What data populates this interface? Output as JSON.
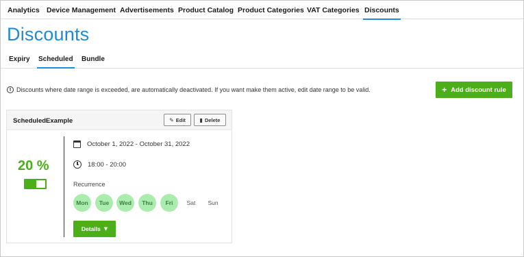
{
  "topnav": {
    "tabs": [
      {
        "label": "Analytics"
      },
      {
        "label": "Device Management"
      },
      {
        "label": "Advertisements"
      },
      {
        "label": "Product Catalog"
      },
      {
        "label": "Product Categories"
      },
      {
        "label": "VAT Categories"
      },
      {
        "label": "Discounts",
        "active": true
      }
    ]
  },
  "page": {
    "title": "Discounts"
  },
  "subnav": {
    "tabs": [
      {
        "label": "Expiry"
      },
      {
        "label": "Scheduled",
        "active": true
      },
      {
        "label": "Bundle"
      }
    ]
  },
  "info": {
    "icon": "info-circle-icon",
    "text": "Discounts where date range is exceeded, are automatically deactivated. If you want make them active, edit date range to be valid."
  },
  "add_button": {
    "label": "Add discount rule",
    "icon": "plus-icon"
  },
  "card": {
    "title": "ScheduledExample",
    "edit_label": "Edit",
    "delete_label": "Delete",
    "percent": "20 %",
    "enabled": true,
    "date_range": "October 1, 2022 - October 31, 2022",
    "time_range": "18:00 - 20:00",
    "recurrence_label": "Recurrence",
    "days": [
      {
        "label": "Mon",
        "active": true
      },
      {
        "label": "Tue",
        "active": true
      },
      {
        "label": "Wed",
        "active": true
      },
      {
        "label": "Thu",
        "active": true
      },
      {
        "label": "Fri",
        "active": true
      },
      {
        "label": "Sat",
        "active": false
      },
      {
        "label": "Sun",
        "active": false
      }
    ],
    "details_label": "Details"
  },
  "colors": {
    "accent_blue": "#1f8ad6",
    "accent_green": "#4caf1a",
    "day_active_bg": "#a9ecae"
  }
}
